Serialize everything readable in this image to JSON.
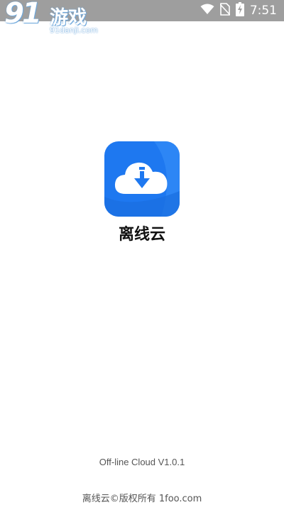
{
  "status_bar": {
    "time": "7:51",
    "icons": [
      "wifi-icon",
      "no-sim-icon",
      "battery-charging-icon"
    ],
    "background": "#9e9e9e"
  },
  "watermark": {
    "logo_number": "91",
    "logo_text": "游戏",
    "url": "91danji.com"
  },
  "app": {
    "name": "离线云",
    "icon": "cloud-download-icon",
    "icon_color": "#1e78f0"
  },
  "footer": {
    "version": "Off-line Cloud V1.0.1",
    "copyright": "离线云©版权所有 1foo.com"
  }
}
